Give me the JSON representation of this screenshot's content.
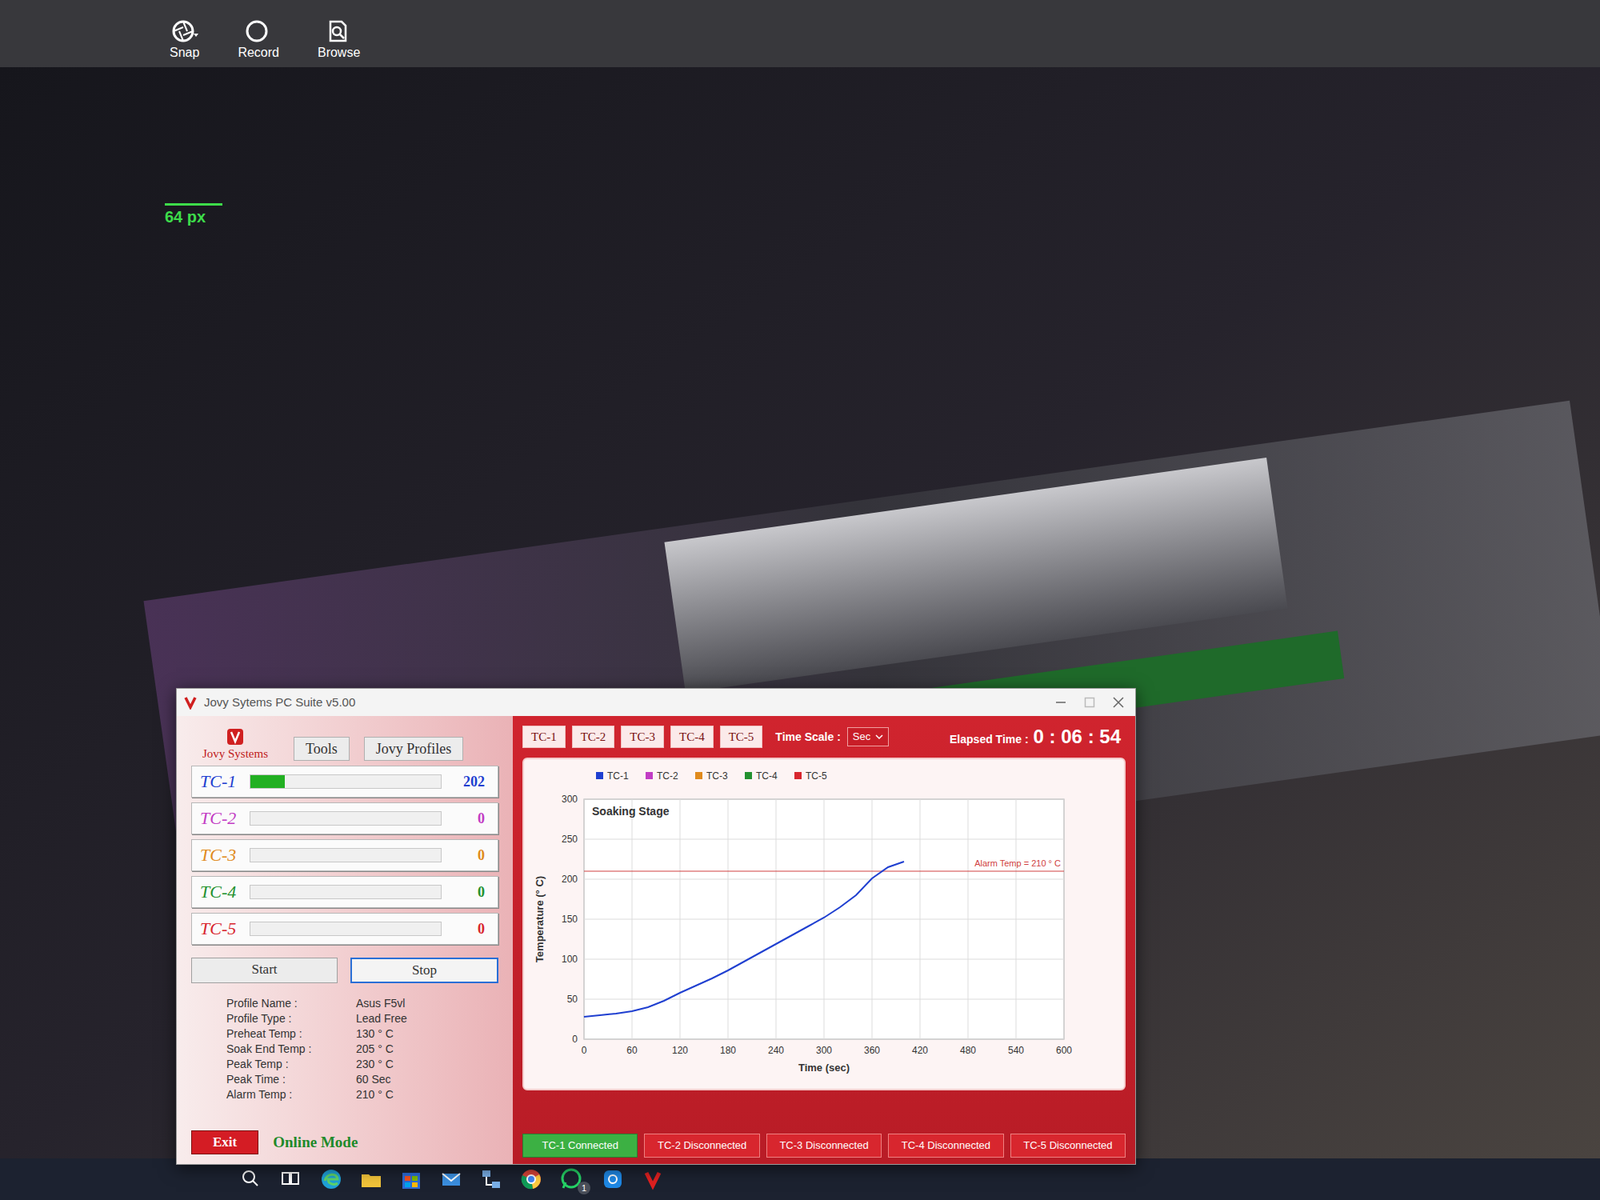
{
  "toolbar": [
    {
      "label": "Snap"
    },
    {
      "label": "Record"
    },
    {
      "label": "Browse"
    }
  ],
  "video": {
    "scale_label": "64 px"
  },
  "app_window": {
    "title": "Jovy Sytems PC Suite v5.00",
    "logo": "Jovy Systems",
    "menu": [
      "Tools",
      "Jovy Profiles"
    ],
    "channels": [
      {
        "name": "TC-1",
        "level": 0.18,
        "reading": "202",
        "color": "#1f3fd0"
      },
      {
        "name": "TC-2",
        "level": 0,
        "reading": "0",
        "color": "#c23cc4"
      },
      {
        "name": "TC-3",
        "level": 0,
        "reading": "0",
        "color": "#e08a1c"
      },
      {
        "name": "TC-4",
        "level": 0,
        "reading": "0",
        "color": "#23912f"
      },
      {
        "name": "TC-5",
        "level": 0,
        "reading": "0",
        "color": "#d8262e"
      }
    ],
    "buttons": [
      {
        "label": "Start",
        "focused": false
      },
      {
        "label": "Stop",
        "focused": true
      }
    ],
    "profile": [
      {
        "label": "Profile Name :",
        "value": "Asus F5vl"
      },
      {
        "label": "Profile Type :",
        "value": "Lead Free"
      },
      {
        "label": "Preheat Temp :",
        "value": "130 ° C"
      },
      {
        "label": "Soak End Temp :",
        "value": "205 ° C"
      },
      {
        "label": "Peak Temp :",
        "value": "230 ° C"
      },
      {
        "label": "Peak Time :",
        "value": "60 Sec"
      },
      {
        "label": "Alarm Temp :",
        "value": "210 ° C"
      }
    ],
    "exit": "Exit",
    "mode": "Online Mode",
    "channel_tabs": [
      "TC-1",
      "TC-2",
      "TC-3",
      "TC-4",
      "TC-5"
    ],
    "time_scale": {
      "label": "Time Scale :",
      "value": "Sec"
    },
    "elapsed": {
      "label": "Elapsed Time :",
      "value": "0 : 06 : 54"
    },
    "chart": {
      "title": "Soaking Stage",
      "legend": [
        {
          "label": "TC-1",
          "color": "#1f3fd0"
        },
        {
          "label": "TC-2",
          "color": "#c23cc4"
        },
        {
          "label": "TC-3",
          "color": "#e08a1c"
        },
        {
          "label": "TC-4",
          "color": "#23912f"
        },
        {
          "label": "TC-5",
          "color": "#d8262e"
        }
      ],
      "y_axis": {
        "label": "Temperature (° C)",
        "ticks": [
          "0",
          "50",
          "100",
          "150",
          "200",
          "250",
          "300"
        ]
      },
      "x_axis": {
        "label": "Time  (sec)",
        "ticks": [
          "0",
          "60",
          "120",
          "180",
          "240",
          "300",
          "360",
          "420",
          "480",
          "540",
          "600"
        ]
      },
      "alarm": {
        "label": "Alarm Temp = 210 ° C",
        "value": 210
      },
      "series": [
        {
          "name": "TC-1",
          "color": "#1f3fd0",
          "times": [
            0,
            20,
            40,
            60,
            80,
            100,
            120,
            140,
            160,
            180,
            200,
            220,
            240,
            260,
            280,
            300,
            320,
            340,
            360,
            380,
            400
          ],
          "values": [
            28,
            30,
            32,
            35,
            40,
            48,
            58,
            67,
            76,
            86,
            97,
            108,
            119,
            130,
            141,
            152,
            165,
            180,
            201,
            215,
            222
          ]
        }
      ]
    },
    "status": [
      {
        "label": "TC-1 Connected",
        "connected": true
      },
      {
        "label": "TC-2 Disconnected",
        "connected": false
      },
      {
        "label": "TC-3 Disconnected",
        "connected": false
      },
      {
        "label": "TC-4 Disconnected",
        "connected": false
      },
      {
        "label": "TC-5 Disconnected",
        "connected": false
      }
    ]
  },
  "taskbar": {
    "badge": "1"
  }
}
